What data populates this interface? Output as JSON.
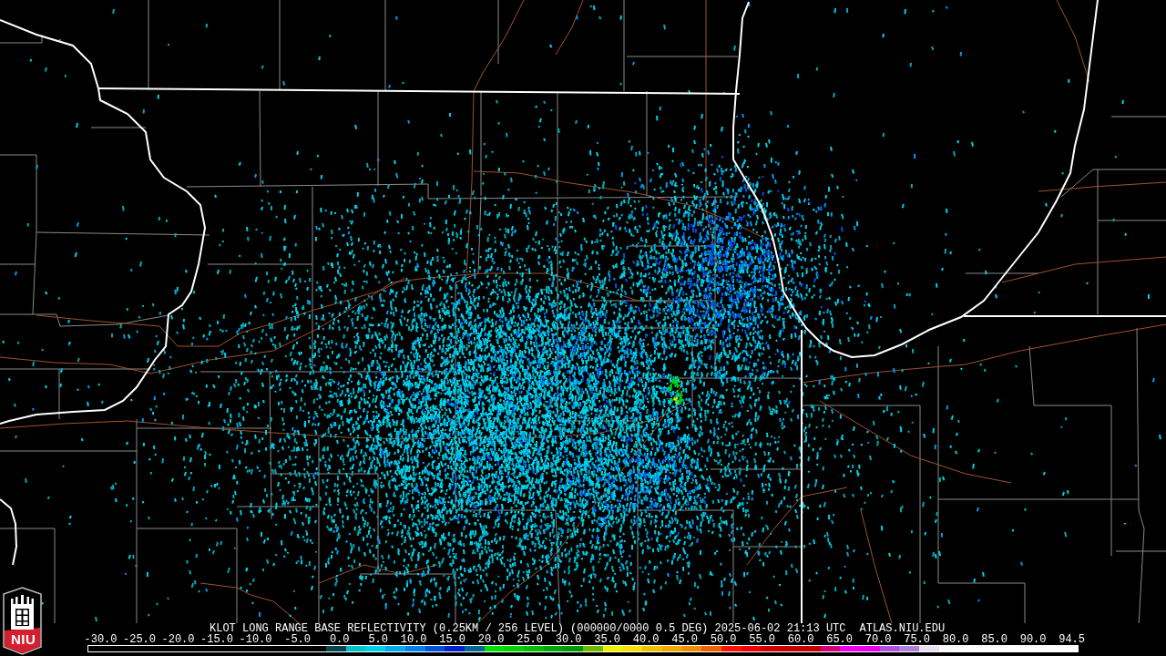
{
  "logo": {
    "text": "NIU"
  },
  "title": "KLOT LONG RANGE BASE REFLECTIVITY (0.25KM / 256 LEVEL) (000000/0000 0.5 DEG) 2025-06-02 21:13 UTC",
  "source": "ATLAS.NIU.EDU",
  "color_scale": {
    "labels": [
      "-30.0",
      "-25.0",
      "-20.0",
      "-15.0",
      "-10.0",
      "-5.0",
      "0.0",
      "5.0",
      "10.0",
      "15.0",
      "20.0",
      "25.0",
      "30.0",
      "35.0",
      "40.0",
      "45.0",
      "50.0",
      "55.0",
      "60.0",
      "65.0",
      "70.0",
      "75.0",
      "80.0",
      "85.0",
      "90.0",
      "94.5"
    ],
    "segments": [
      {
        "color": "#00464a"
      },
      {
        "color": "#00c0c8"
      },
      {
        "color": "#00d0e8"
      },
      {
        "color": "#00a8f0"
      },
      {
        "color": "#0080f0"
      },
      {
        "color": "#0050e0"
      },
      {
        "color": "#0020d0"
      },
      {
        "color": "#006890"
      },
      {
        "color": "#00e000"
      },
      {
        "color": "#00d400"
      },
      {
        "color": "#00c000"
      },
      {
        "color": "#00a800"
      },
      {
        "color": "#009800"
      },
      {
        "color": "#70b800"
      },
      {
        "color": "#f0f000"
      },
      {
        "color": "#f8e000"
      },
      {
        "color": "#f0c000"
      },
      {
        "color": "#f0a800"
      },
      {
        "color": "#f08c00"
      },
      {
        "color": "#f06000"
      },
      {
        "color": "#ff1000"
      },
      {
        "color": "#f00000"
      },
      {
        "color": "#d00000"
      },
      {
        "color": "#c80000"
      },
      {
        "color": "#c40000"
      },
      {
        "color": "#d0007c"
      },
      {
        "color": "#f000f0"
      },
      {
        "color": "#e800f0"
      },
      {
        "color": "#b050e0"
      },
      {
        "color": "#b080d8"
      },
      {
        "color": "#e8e0f0"
      },
      {
        "color": "#fafafa"
      },
      {
        "color": "#ffffff"
      },
      {
        "color": "#ffffff"
      },
      {
        "color": "#ffffff"
      },
      {
        "color": "#ffffff"
      },
      {
        "color": "#ffffff"
      },
      {
        "color": "#ffffff"
      }
    ]
  }
}
